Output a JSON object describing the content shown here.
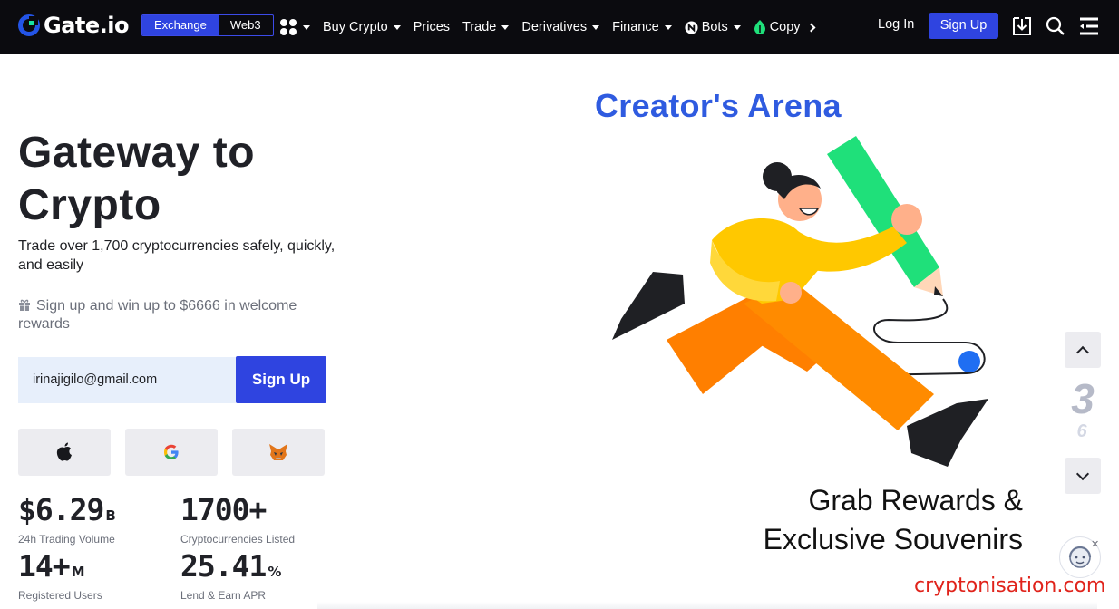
{
  "header": {
    "logo_text": "Gate.io",
    "mode_toggle": [
      "Exchange",
      "Web3"
    ],
    "nav": [
      {
        "label": "Buy Crypto",
        "has_caret": true
      },
      {
        "label": "Prices",
        "has_caret": false
      },
      {
        "label": "Trade",
        "has_caret": true
      },
      {
        "label": "Derivatives",
        "has_caret": true
      },
      {
        "label": "Finance",
        "has_caret": true
      },
      {
        "label": "Bots",
        "has_caret": true,
        "icon": "bots-icon"
      },
      {
        "label": "Copy",
        "has_caret": false,
        "icon": "leaf-icon"
      }
    ],
    "login_label": "Log In",
    "signup_label": "Sign Up",
    "icons": [
      "apps-grid-icon",
      "download-icon",
      "search-icon",
      "menu-icon"
    ]
  },
  "hero": {
    "title_line1": "Gateway to",
    "title_line2": "Crypto",
    "subtitle": "Trade over 1,700 cryptocurrencies safely, quickly, and easily",
    "promo": "Sign up and win up to $6666 in welcome rewards",
    "email_value": "irinajigilo@gmail.com",
    "signup_button": "Sign Up",
    "social_logins": [
      "apple-icon",
      "google-icon",
      "metamask-icon"
    ]
  },
  "stats": [
    {
      "value": "$6.29",
      "unit": "B",
      "label": "24h Trading Volume"
    },
    {
      "value": "1700+",
      "unit": "",
      "label": "Cryptocurrencies Listed"
    },
    {
      "value": "14+",
      "unit": "M",
      "label": "Registered Users"
    },
    {
      "value": "25.41",
      "unit": "%",
      "label": "Lend & Earn APR"
    }
  ],
  "banner": {
    "title": "Creator's Arena",
    "line1": "Grab Rewards &",
    "line2": "Exclusive Souvenirs"
  },
  "carousel": {
    "current": "3",
    "total": "6"
  },
  "watermark": "cryptonisation.com",
  "colors": {
    "brand_blue": "#2f44e0",
    "topbar_bg": "#0b0b0f",
    "banner_title": "#2f5be0",
    "green_accent": "#1fe07a"
  }
}
